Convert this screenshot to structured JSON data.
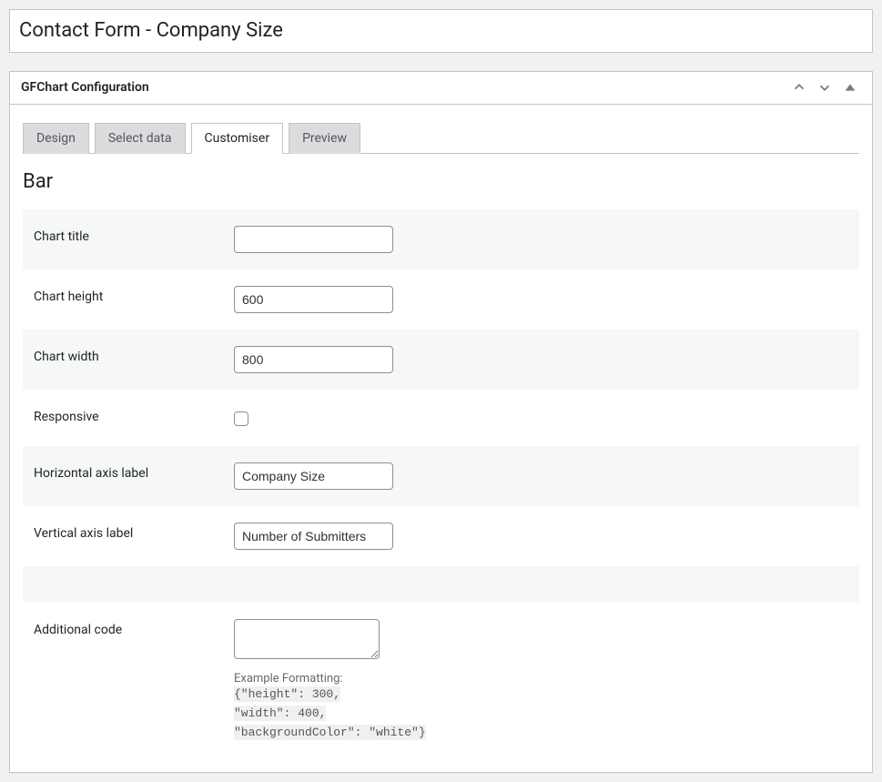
{
  "page": {
    "title": "Contact Form - Company Size"
  },
  "metabox": {
    "title": "GFChart Configuration"
  },
  "tabs": {
    "design": "Design",
    "select_data": "Select data",
    "customiser": "Customiser",
    "preview": "Preview"
  },
  "section": {
    "heading": "Bar"
  },
  "fields": {
    "chart_title_label": "Chart title",
    "chart_title_value": "",
    "chart_height_label": "Chart height",
    "chart_height_value": "600",
    "chart_width_label": "Chart width",
    "chart_width_value": "800",
    "responsive_label": "Responsive",
    "haxis_label": "Horizontal axis label",
    "haxis_value": "Company Size",
    "vaxis_label": "Vertical axis label",
    "vaxis_value": "Number of Submitters",
    "additional_code_label": "Additional code",
    "additional_code_value": "",
    "example_heading": "Example Formatting:",
    "example_line1": " {\"height\": 300,",
    "example_line2": "\"width\": 400,",
    "example_line3": "\"backgroundColor\": \"white\"}"
  }
}
